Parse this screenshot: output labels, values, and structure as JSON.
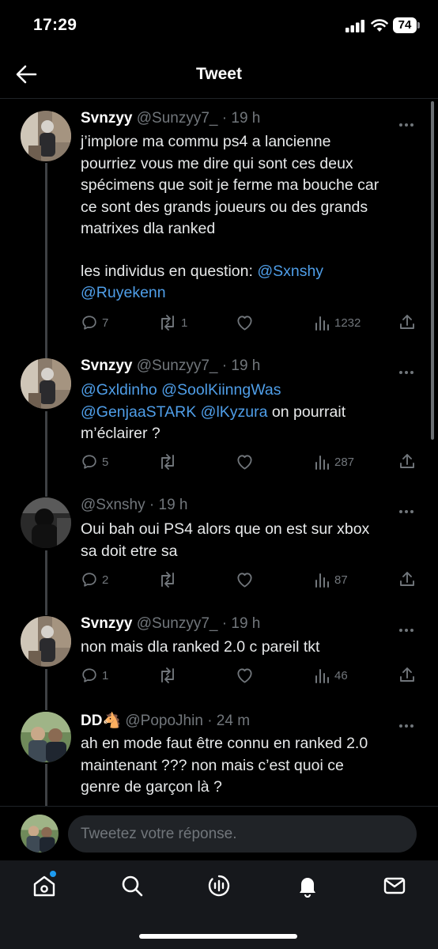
{
  "status_bar": {
    "time": "17:29",
    "battery": "74"
  },
  "header": {
    "title": "Tweet"
  },
  "tweets": [
    {
      "name": "Svnzyy",
      "handle": "@Sunzyy7_",
      "time": "· 19 h",
      "lines": [
        "j’implore ma commu ps4 a lancienne",
        "pourriez vous me dire qui sont ces deux",
        "spécimens que soit je ferme ma bouche car",
        "ce sont des grands joueurs ou des grands",
        "matrixes dla ranked"
      ],
      "line2_text": "les individus en question: ",
      "line2_mention": "@Sxnshy",
      "line3_mention": "@Ruyekenn",
      "replies": "7",
      "retweets": "1",
      "likes": "",
      "views": "1232"
    },
    {
      "name": "Svnzyy",
      "handle": "@Sunzyy7_",
      "time": "· 19 h",
      "mentions_line1": "@Gxldinho @SoolKiinngWas",
      "mentions_line2": "@GenjaaSTARK @lKyzura",
      "tail_line2": " on pourrait",
      "line3": "m’éclairer ?",
      "replies": "5",
      "retweets": "",
      "likes": "",
      "views": "287"
    },
    {
      "name": "",
      "handle": "@Sxnshy",
      "time": "· 19 h",
      "lines": [
        "Oui bah oui PS4 alors que on est sur xbox",
        "sa doit etre sa"
      ],
      "replies": "2",
      "retweets": "",
      "likes": "",
      "views": "87"
    },
    {
      "name": "Svnzyy",
      "handle": "@Sunzyy7_",
      "time": "· 19 h",
      "lines": [
        "non mais dla ranked 2.0 c pareil tkt"
      ],
      "replies": "1",
      "retweets": "",
      "likes": "",
      "views": "46"
    },
    {
      "name": "DD🐴",
      "handle": "@PopoJhin",
      "time": "· 24 m",
      "lines": [
        "ah en mode faut être connu en ranked 2.0",
        "maintenant ??? non mais c’est quoi ce",
        "genre de garçon là ?"
      ]
    }
  ],
  "reply_bar": {
    "placeholder": "Tweetez votre réponse."
  },
  "nav": [
    "home-icon",
    "search-icon",
    "spaces-icon",
    "notifications-icon",
    "messages-icon"
  ],
  "colors": {
    "background": "#000000",
    "mention": "#4f9ee8",
    "muted": "#71767b",
    "accent": "#1d9bf0"
  }
}
